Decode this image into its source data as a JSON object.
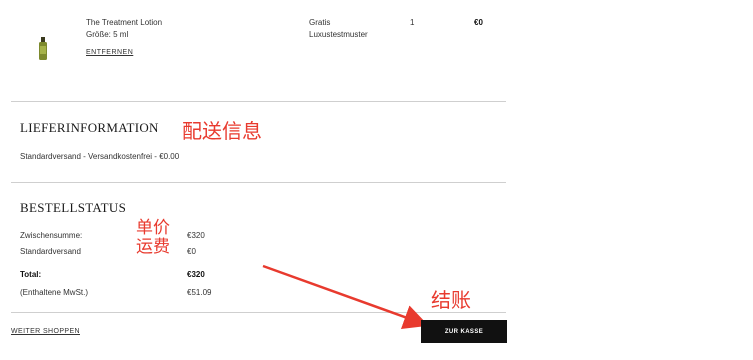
{
  "cart_item": {
    "name": "The Treatment Lotion",
    "size": "Größe: 5 ml",
    "remove_label": "ENTFERNEN",
    "price_label": "Gratis",
    "price_sub": "Luxustestmuster",
    "quantity": "1",
    "total": "€0",
    "image_icon": "lotion-bottle-icon"
  },
  "shipping": {
    "title": "LIEFERINFORMATION",
    "text": "Standardversand - Versandkostenfrei - €0.00"
  },
  "order_status": {
    "title": "BESTELLSTATUS",
    "rows": [
      {
        "label": "Zwischensumme:",
        "value": "€320"
      },
      {
        "label": "Standardversand",
        "value": "€0"
      },
      {
        "label": "Total:",
        "value": "€320"
      },
      {
        "label": "(Enthaltene MwSt.)",
        "value": "€51.09"
      }
    ]
  },
  "annotations": {
    "shipping": "配送信息",
    "unit_price": "单价",
    "shipping_fee": "运费",
    "checkout": "结账",
    "color": "#e83a2e"
  },
  "footer": {
    "continue_label": "WEITER SHOPPEN",
    "checkout_label": "ZUR KASSE"
  }
}
